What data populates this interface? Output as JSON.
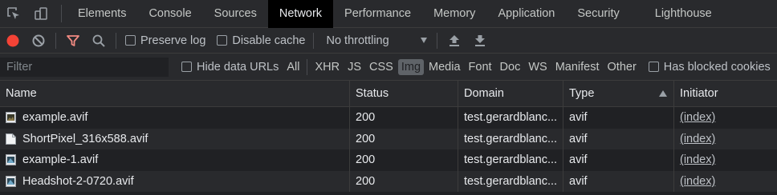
{
  "tabs": [
    {
      "label": "Elements"
    },
    {
      "label": "Console"
    },
    {
      "label": "Sources"
    },
    {
      "label": "Network"
    },
    {
      "label": "Performance"
    },
    {
      "label": "Memory"
    },
    {
      "label": "Application"
    },
    {
      "label": "Security"
    },
    {
      "label": "Lighthouse"
    }
  ],
  "active_tab": "Network",
  "toolbar": {
    "preserve_log": "Preserve log",
    "disable_cache": "Disable cache",
    "throttling": "No throttling"
  },
  "filterbar": {
    "placeholder": "Filter",
    "hide_data_urls": "Hide data URLs",
    "types": [
      "All",
      "XHR",
      "JS",
      "CSS",
      "Img",
      "Media",
      "Font",
      "Doc",
      "WS",
      "Manifest",
      "Other"
    ],
    "selected_type": "Img",
    "has_blocked_cookies": "Has blocked cookies"
  },
  "table": {
    "headers": {
      "name": "Name",
      "status": "Status",
      "domain": "Domain",
      "type": "Type",
      "initiator": "Initiator"
    },
    "rows": [
      {
        "name": "example.avif",
        "status": "200",
        "domain": "test.gerardblanc...",
        "type": "avif",
        "initiator": "(index)",
        "icon": "image-file-icon"
      },
      {
        "name": "ShortPixel_316x588.avif",
        "status": "200",
        "domain": "test.gerardblanc...",
        "type": "avif",
        "initiator": "(index)",
        "icon": "blank-file-icon"
      },
      {
        "name": "example-1.avif",
        "status": "200",
        "domain": "test.gerardblanc...",
        "type": "avif",
        "initiator": "(index)",
        "icon": "image-file-icon"
      },
      {
        "name": "Headshot-2-0720.avif",
        "status": "200",
        "domain": "test.gerardblanc...",
        "type": "avif",
        "initiator": "(index)",
        "icon": "image-file-icon"
      }
    ]
  },
  "colors": {
    "record": "#f44336",
    "filter_active": "#f28b82",
    "panel_bg": "#292a2d",
    "body_bg": "#202124"
  }
}
